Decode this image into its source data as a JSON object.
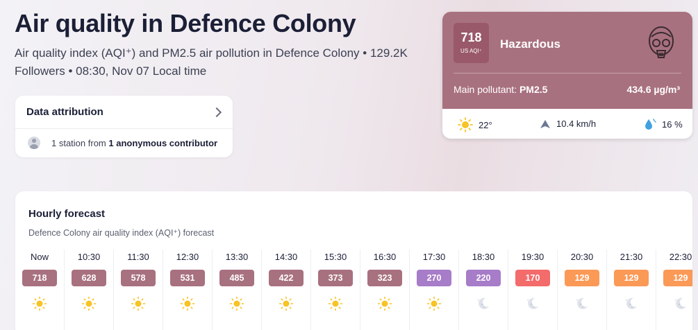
{
  "header": {
    "title": "Air quality in Defence Colony",
    "subtitle": "Air quality index (AQI⁺) and PM2.5 air pollution in Defence Colony • 129.2K Followers • 08:30, Nov 07 Local time"
  },
  "attribution": {
    "title": "Data attribution",
    "station_prefix": "1 station from ",
    "station_contributor": "1 anonymous contributor"
  },
  "aqi_card": {
    "value": "718",
    "unit": "US AQI⁺",
    "level": "Hazardous",
    "pollutant_label": "Main pollutant: ",
    "pollutant": "PM2.5",
    "concentration": "434.6 µg/m³",
    "color": "#a8717f",
    "weather": {
      "temperature": "22°",
      "wind": "10.4 km/h",
      "humidity": "16 %"
    }
  },
  "forecast": {
    "title": "Hourly forecast",
    "subtitle": "Defence Colony air quality index (AQI⁺) forecast",
    "hours": [
      {
        "time": "Now",
        "aqi": "718",
        "color": "#a8717f",
        "icon": "sun-icon"
      },
      {
        "time": "10:30",
        "aqi": "628",
        "color": "#a8717f",
        "icon": "sun-icon"
      },
      {
        "time": "11:30",
        "aqi": "578",
        "color": "#a8717f",
        "icon": "sun-icon"
      },
      {
        "time": "12:30",
        "aqi": "531",
        "color": "#a8717f",
        "icon": "sun-icon"
      },
      {
        "time": "13:30",
        "aqi": "485",
        "color": "#a8717f",
        "icon": "sun-icon"
      },
      {
        "time": "14:30",
        "aqi": "422",
        "color": "#a8717f",
        "icon": "sun-icon"
      },
      {
        "time": "15:30",
        "aqi": "373",
        "color": "#a8717f",
        "icon": "sun-icon"
      },
      {
        "time": "16:30",
        "aqi": "323",
        "color": "#a8717f",
        "icon": "sun-icon"
      },
      {
        "time": "17:30",
        "aqi": "270",
        "color": "#a77cc8",
        "icon": "sun-icon"
      },
      {
        "time": "18:30",
        "aqi": "220",
        "color": "#a77cc8",
        "icon": "moon-icon"
      },
      {
        "time": "19:30",
        "aqi": "170",
        "color": "#f36b6b",
        "icon": "moon-icon"
      },
      {
        "time": "20:30",
        "aqi": "129",
        "color": "#fb9956",
        "icon": "moon-icon"
      },
      {
        "time": "21:30",
        "aqi": "129",
        "color": "#fb9956",
        "icon": "moon-icon"
      },
      {
        "time": "22:30",
        "aqi": "129",
        "color": "#fb9956",
        "icon": "moon-icon"
      }
    ]
  }
}
